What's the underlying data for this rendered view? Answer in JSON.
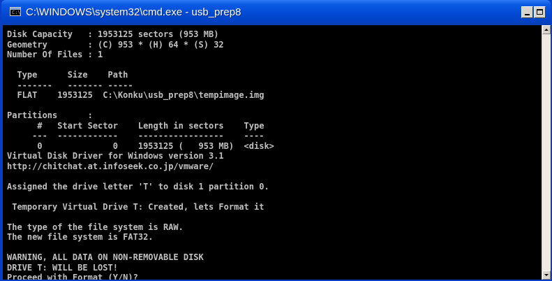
{
  "window": {
    "title": "C:\\WINDOWS\\system32\\cmd.exe - usb_prep8",
    "icon": "console-icon",
    "icon_text": "C:\\"
  },
  "console": {
    "lines": [
      "Disk Capacity   : 1953125 sectors (953 MB)",
      "Geometry        : (C) 953 * (H) 64 * (S) 32",
      "Number Of Files : 1",
      "",
      "  Type      Size    Path",
      "  -------   ------- -----",
      "  FLAT    1953125  C:\\Konku\\usb_prep8\\tempimage.img",
      "",
      "Partitions      :",
      "      #   Start Sector    Length in sectors    Type",
      "     ---  ------------    -----------------    ----",
      "      0              0    1953125 (   953 MB)  <disk>",
      "Virtual Disk Driver for Windows version 3.1",
      "http://chitchat.at.infoseek.co.jp/vmware/",
      "",
      "Assigned the drive letter 'T' to disk 1 partition 0.",
      "",
      " Temporary Virtual Drive T: Created, lets Format it",
      "",
      "The type of the file system is RAW.",
      "The new file system is FAT32.",
      "",
      "WARNING, ALL DATA ON NON-REMOVABLE DISK",
      "DRIVE T: WILL BE LOST!",
      "Proceed with Format (Y/N)?"
    ]
  },
  "colors": {
    "titlebar": "#0349d4",
    "console_bg": "#000000",
    "console_text": "#c0c0c0"
  }
}
